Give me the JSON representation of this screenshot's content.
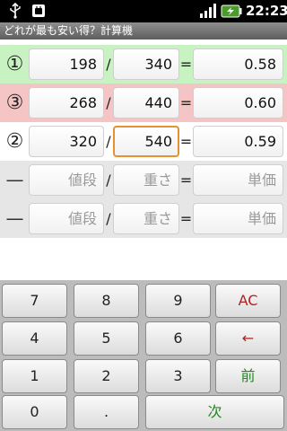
{
  "status_bar": {
    "time": "22:23"
  },
  "app": {
    "title": "どれが最も安い得？計算機"
  },
  "rows": [
    {
      "rank": "①",
      "value": "198",
      "weight": "340",
      "unit_price": "0.58"
    },
    {
      "rank": "③",
      "value": "268",
      "weight": "440",
      "unit_price": "0.60"
    },
    {
      "rank": "②",
      "value": "320",
      "weight": "540",
      "unit_price": "0.59"
    },
    {
      "rank": "—",
      "value_placeholder": "値段",
      "weight_placeholder": "重さ",
      "unit_price_placeholder": "単価"
    },
    {
      "rank": "—",
      "value_placeholder": "値段",
      "weight_placeholder": "重さ",
      "unit_price_placeholder": "単価"
    }
  ],
  "operators": {
    "slash": "/",
    "equals": "="
  },
  "keypad": {
    "k7": "7",
    "k8": "8",
    "k9": "9",
    "ac": "AC",
    "k4": "4",
    "k5": "5",
    "k6": "6",
    "back": "←",
    "k1": "1",
    "k2": "2",
    "k3": "3",
    "prev": "前",
    "k0": "0",
    "dot": ".",
    "next": "次"
  },
  "colors": {
    "best_row": "#c8f2c2",
    "worst_row": "#f5c4c4",
    "empty_row": "#e6e6e6",
    "selected_border": "#e7912e",
    "ac_text": "#b12222",
    "nav_text": "#1f8a1f"
  }
}
